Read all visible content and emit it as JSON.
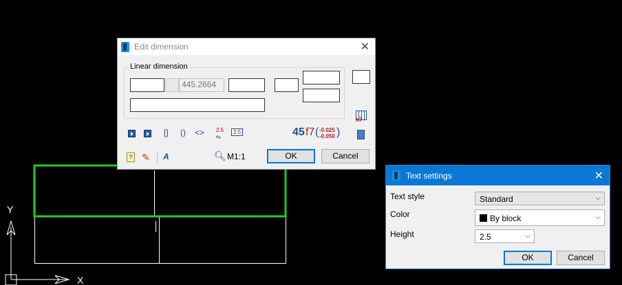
{
  "canvas": {
    "axis_x_label": "X",
    "axis_y_label": "Y",
    "colors": {
      "background": "#000000",
      "lines": "#ffffff",
      "selection": "#22cc22"
    }
  },
  "edit_dimension": {
    "title": "Edit dimension",
    "group_label": "Linear dimension",
    "measured_value": "445.2664",
    "tolerance_preview": {
      "nominal": "45",
      "fit": "f7",
      "upper": "-0.025",
      "lower": "-0.050"
    },
    "toolbar": {
      "brackets_square": "[]",
      "brackets_round": "()",
      "brackets_angle": "<>",
      "value_25": "2.5",
      "value_25_box": "2.5",
      "fit_icon_label": "h7"
    },
    "scale_label": "M1:1",
    "ok_label": "OK",
    "cancel_label": "Cancel"
  },
  "text_settings": {
    "title": "Text settings",
    "text_style_label": "Text style",
    "text_style_value": "Standard",
    "color_label": "Color",
    "color_value": "By block",
    "height_label": "Height",
    "height_value": "2.5",
    "ok_label": "OK",
    "cancel_label": "Cancel"
  }
}
